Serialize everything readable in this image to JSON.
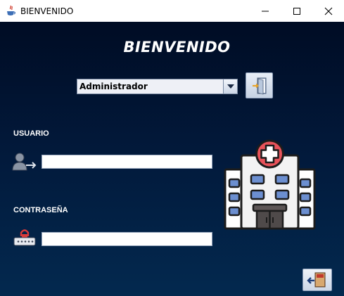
{
  "window": {
    "title": "BIENVENIDO"
  },
  "main": {
    "heading": "BIENVENIDO",
    "role_select": {
      "value": "Administrador"
    },
    "user_label": "USUARIO",
    "password_label": "CONTRASEÑA",
    "user_value": "",
    "password_value": ""
  },
  "icons": {
    "title_icon": "java-icon",
    "login_button_icon": "enter-door-icon",
    "user_icon": "user-arrow-icon",
    "password_icon": "padlock-keypad-icon",
    "illustration": "hospital-building-icon",
    "exit_button_icon": "exit-door-icon"
  },
  "colors": {
    "background_top": "#000c24",
    "background_bottom": "#03294f",
    "hospital_cross": "#e8535a",
    "text": "#ffffff"
  }
}
